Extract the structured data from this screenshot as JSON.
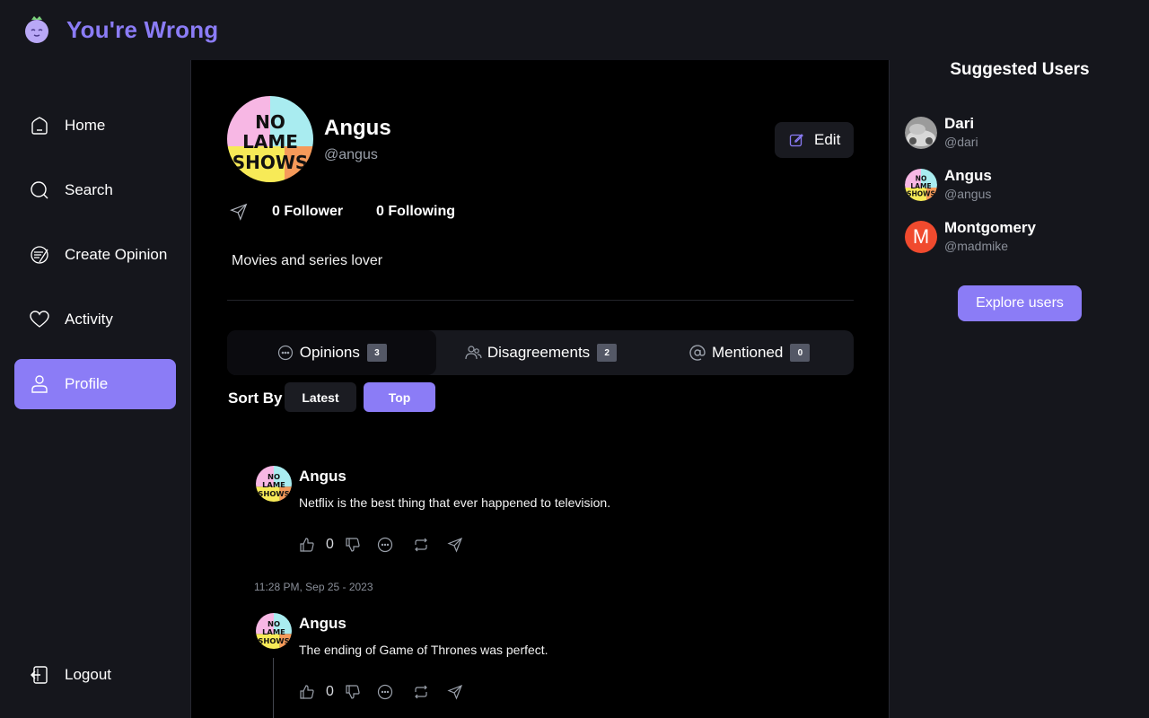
{
  "app": {
    "name": "You're Wrong"
  },
  "nav": {
    "home": "Home",
    "search": "Search",
    "create": "Create Opinion",
    "activity": "Activity",
    "profile": "Profile",
    "logout": "Logout"
  },
  "profile": {
    "name": "Angus",
    "handle": "@angus",
    "edit_label": "Edit",
    "followers": "0 Follower",
    "following": "0 Following",
    "bio": "Movies and series lover",
    "avatar_text": [
      "NO",
      "LAME",
      "SHOWS"
    ]
  },
  "tabs": [
    {
      "label": "Opinions",
      "count": "3",
      "icon": "chat-bubble-icon"
    },
    {
      "label": "Disagreements",
      "count": "2",
      "icon": "users-icon"
    },
    {
      "label": "Mentioned",
      "count": "0",
      "icon": "at-icon"
    }
  ],
  "sort": {
    "label": "Sort By",
    "latest": "Latest",
    "top": "Top",
    "selected": "Top"
  },
  "posts": [
    {
      "author": "Angus",
      "text": "Netflix is the best thing that ever happened to television.",
      "likes": "0"
    },
    {
      "author": "Angus",
      "text": "The ending of Game of Thrones was perfect.",
      "likes": "0"
    }
  ],
  "timestamp": "11:28 PM, Sep 25 - 2023",
  "suggested": {
    "title": "Suggested Users",
    "users": [
      {
        "name": "Dari",
        "handle": "@dari"
      },
      {
        "name": "Angus",
        "handle": "@angus"
      },
      {
        "name": "Montgomery",
        "handle": "@madmike",
        "initial": "M"
      }
    ],
    "explore_label": "Explore users"
  },
  "colors": {
    "accent": "#8b7cf6",
    "background": "#15161c",
    "main": "#000000",
    "letter_avatar": "#f04a2e"
  }
}
